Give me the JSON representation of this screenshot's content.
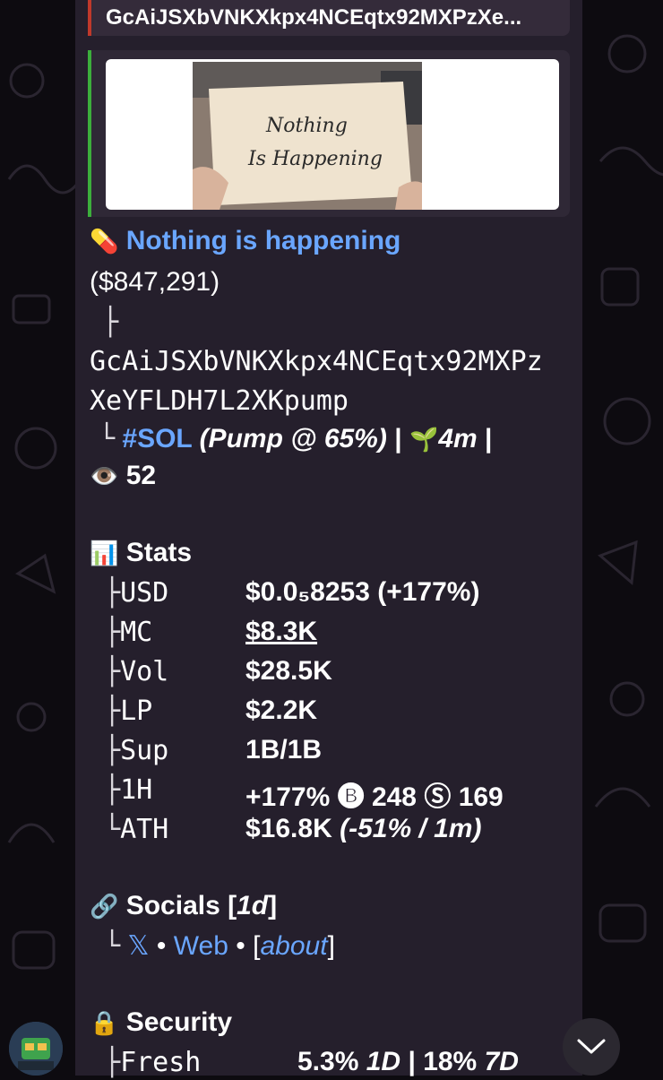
{
  "reply": {
    "text": "GcAiJSXbVNKXkpx4NCEqtx92MXPzXe..."
  },
  "token": {
    "name": "Nothing is happening",
    "price_line": "($847,291)",
    "tree_top": "├",
    "address_1": "GcAiJSXbVNKXkpx4NCEqtx92MXPz",
    "address_2": "XeYFLDH7L2XKpump",
    "chain": "#SOL",
    "pump_prefix": "(Pump @ ",
    "pump_pct": "65%",
    "pump_suffix": ")",
    "sep1": "|",
    "age": "4m",
    "sep2": "|",
    "views": "52"
  },
  "preview_image": {
    "line1": "Nothing",
    "line2": "Is Happening"
  },
  "stats": {
    "title": "Stats",
    "rows": [
      {
        "branch": "├",
        "key": "USD",
        "value": "$0.0₅8253 (+177%)"
      },
      {
        "branch": "├",
        "key": "MC",
        "value": "$8.3K"
      },
      {
        "branch": "├",
        "key": "Vol",
        "value": "$28.5K"
      },
      {
        "branch": "├",
        "key": "LP",
        "value": "$2.2K"
      },
      {
        "branch": "├",
        "key": "Sup",
        "value": "1B/1B"
      },
      {
        "branch": "├",
        "key": "1H",
        "value": "+177%"
      },
      {
        "branch": "└",
        "key": "ATH",
        "value": "$16.8K"
      }
    ],
    "buys": "248",
    "sells": "169",
    "ath_extra": "(-51% / 1m)"
  },
  "socials": {
    "title": "Socials [",
    "age": "1d",
    "title_end": "]",
    "branch": "└",
    "x_link": "𝕏",
    "dot1": "•",
    "web_link": "Web",
    "dot2": "•",
    "about_open": "[",
    "about_link": "about",
    "about_close": "]"
  },
  "security": {
    "title": "Security",
    "branch": "├",
    "key": "Fresh",
    "val_1": "5.3%",
    "val_1_suffix": "1D",
    "sep": "|",
    "val_2": "18%",
    "val_2_suffix": "7D"
  },
  "colors": {
    "bubble": "#251f2c",
    "link": "#6aa6ff",
    "reply_bar": "#c0392b",
    "preview_bar": "#3cae3c"
  }
}
